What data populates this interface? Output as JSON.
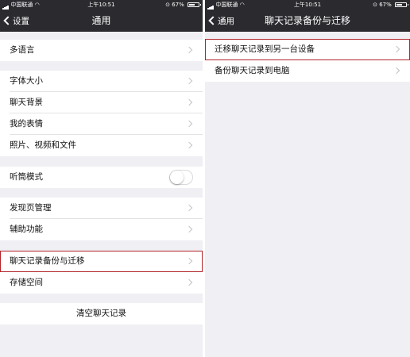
{
  "colors": {
    "navbar": "#2b2b2f",
    "background": "#efeff4",
    "highlight": "#b2252b"
  },
  "left_screen": {
    "status": {
      "carrier": "中国联通",
      "time": "上午10:51",
      "battery": "67%",
      "battery_level": 0.67
    },
    "nav": {
      "back_label": "设置",
      "title": "通用"
    },
    "items": {
      "language": "多语言",
      "font_size": "字体大小",
      "chat_background": "聊天背景",
      "my_stickers": "我的表情",
      "photos_videos_files": "照片、视频和文件",
      "earpiece_mode": "听筒模式",
      "discover_management": "发现页管理",
      "accessibility": "辅助功能",
      "chat_backup_migration": "聊天记录备份与迁移",
      "storage": "存储空间",
      "clear_chat_history": "清空聊天记录"
    },
    "earpiece_toggle_on": false
  },
  "right_screen": {
    "status": {
      "carrier": "中国联通",
      "time": "上午10:51",
      "battery": "67%",
      "battery_level": 0.67
    },
    "nav": {
      "back_label": "通用",
      "title": "聊天记录备份与迁移"
    },
    "items": {
      "migrate_to_device": "迁移聊天记录到另一台设备",
      "backup_to_pc": "备份聊天记录到电脑"
    }
  }
}
